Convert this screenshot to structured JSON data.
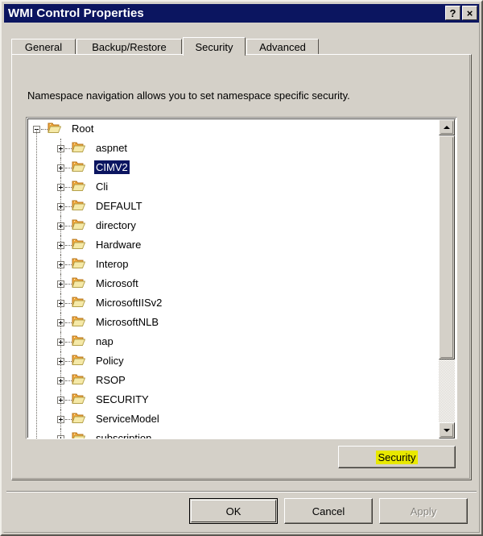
{
  "window": {
    "title": "WMI Control Properties",
    "help_button": "?",
    "close_button": "×"
  },
  "tabs": [
    {
      "label": "General",
      "active": false
    },
    {
      "label": "Backup/Restore",
      "active": false
    },
    {
      "label": "Security",
      "active": true
    },
    {
      "label": "Advanced",
      "active": false
    }
  ],
  "security_page": {
    "description": "Namespace navigation allows you to set namespace specific security.",
    "tree": {
      "root": {
        "label": "Root",
        "expander": "minus",
        "selected": false
      },
      "children": [
        {
          "label": "aspnet",
          "expander": "plus",
          "selected": false
        },
        {
          "label": "CIMV2",
          "expander": "plus",
          "selected": true
        },
        {
          "label": "Cli",
          "expander": "plus",
          "selected": false
        },
        {
          "label": "DEFAULT",
          "expander": "plus",
          "selected": false
        },
        {
          "label": "directory",
          "expander": "plus",
          "selected": false
        },
        {
          "label": "Hardware",
          "expander": "plus",
          "selected": false
        },
        {
          "label": "Interop",
          "expander": "plus",
          "selected": false
        },
        {
          "label": "Microsoft",
          "expander": "plus",
          "selected": false
        },
        {
          "label": "MicrosoftIISv2",
          "expander": "plus",
          "selected": false
        },
        {
          "label": "MicrosoftNLB",
          "expander": "plus",
          "selected": false
        },
        {
          "label": "nap",
          "expander": "plus",
          "selected": false
        },
        {
          "label": "Policy",
          "expander": "plus",
          "selected": false
        },
        {
          "label": "RSOP",
          "expander": "plus",
          "selected": false
        },
        {
          "label": "SECURITY",
          "expander": "plus",
          "selected": false
        },
        {
          "label": "ServiceModel",
          "expander": "plus",
          "selected": false
        },
        {
          "label": "subscription",
          "expander": "plus",
          "selected": false
        }
      ],
      "selection_color": "#0b1560"
    },
    "scrollbar": {
      "up_arrow": "▲",
      "down_arrow": "▼",
      "thumb_top_pct": 0,
      "thumb_height_pct": 78
    },
    "security_button": {
      "label": "Security",
      "highlight_color": "#e8e800"
    }
  },
  "dialog_buttons": {
    "ok": {
      "label": "OK",
      "default": true,
      "disabled": false
    },
    "cancel": {
      "label": "Cancel",
      "default": false,
      "disabled": false
    },
    "apply": {
      "label": "Apply",
      "default": false,
      "disabled": true
    }
  },
  "theme": {
    "face": "#d4d0c8",
    "titlebar": "#0b1560",
    "folder_body": "#f0a63c",
    "folder_front": "#f5e9a8"
  }
}
